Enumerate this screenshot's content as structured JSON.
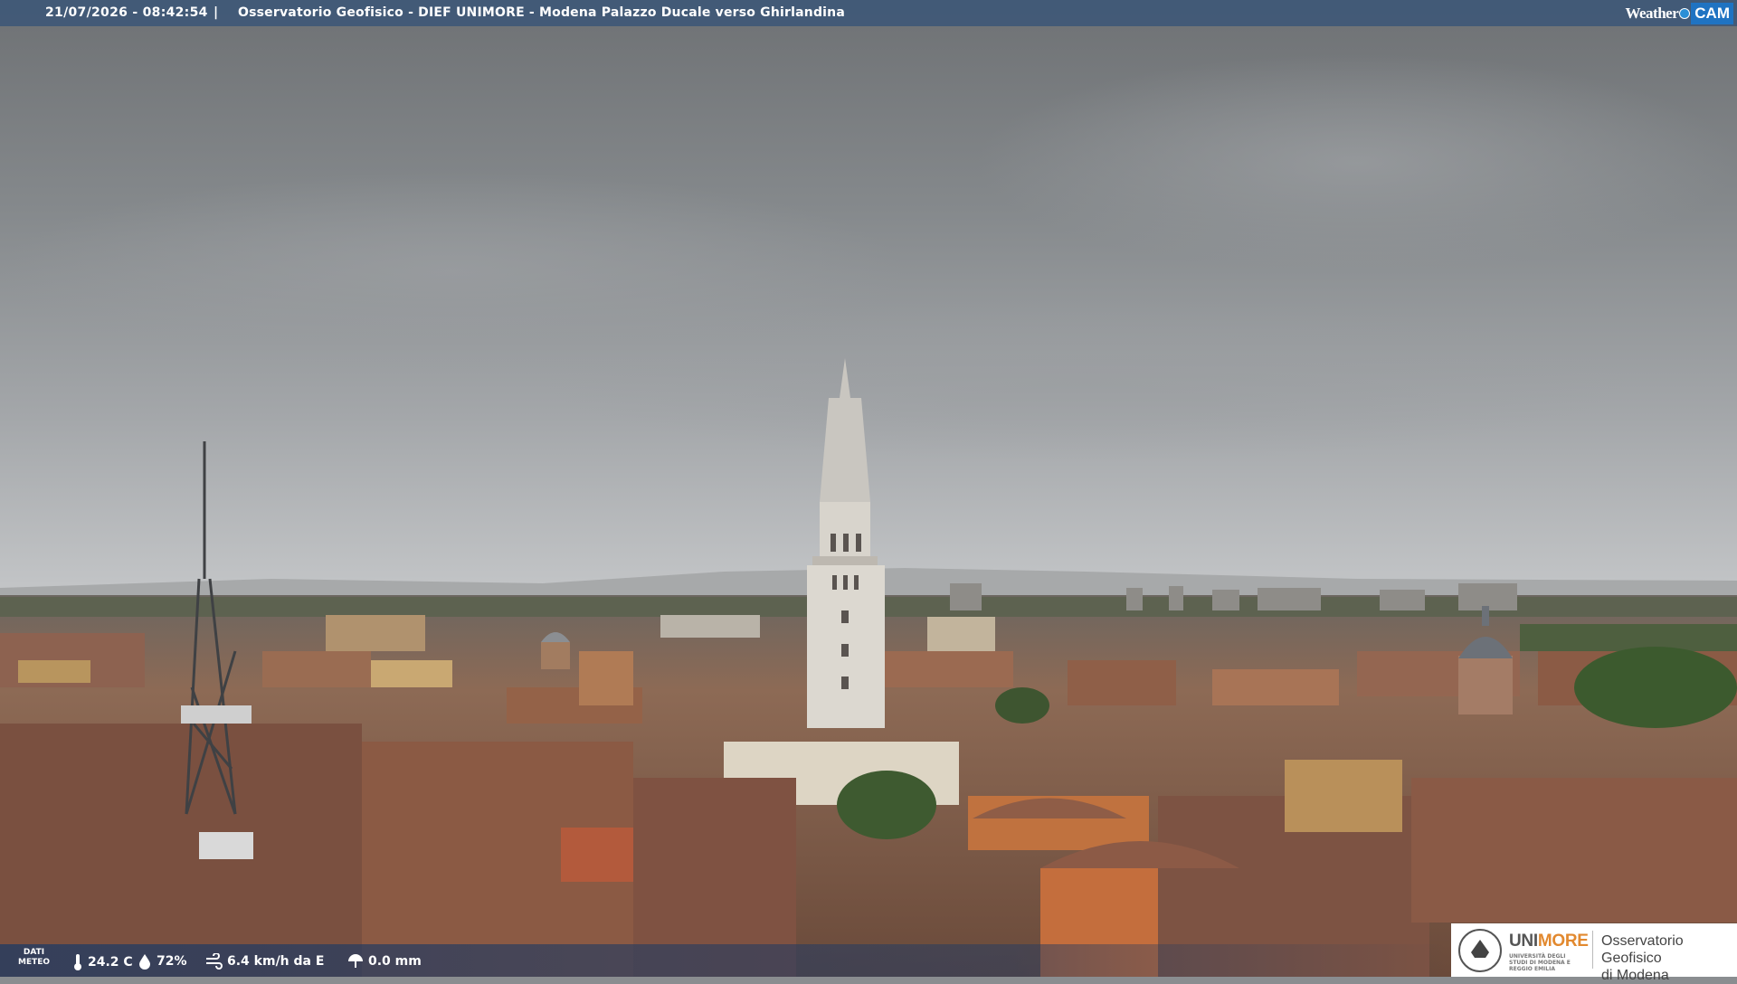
{
  "header": {
    "timestamp": "21/07/2026 - 08:42:54",
    "separator": "|",
    "title": "Osservatorio Geofisico - DIEF UNIMORE - Modena Palazzo Ducale verso Ghirlandina"
  },
  "brand": {
    "weather": "Weather",
    "cam": "CAM"
  },
  "weather": {
    "label_line1": "DATI",
    "label_line2": "METEO",
    "temperature": "24.2 C",
    "humidity": "72%",
    "wind": "6.4 km/h da E",
    "rain": "0.0 mm",
    "icons": [
      "thermometer-icon",
      "humidity-drop-icon",
      "wind-icon",
      "rain-umbrella-icon"
    ]
  },
  "logo": {
    "unimore_uni": "UNI",
    "unimore_more": "MORE",
    "unimore_sub": "UNIVERSITÀ DEGLI STUDI DI MODENA E REGGIO EMILIA",
    "observatory_line1": "Osservatorio Geofisico",
    "observatory_line2": "di Modena"
  },
  "colors": {
    "bar": "#3c5678",
    "cam_blue": "#1f73c2",
    "unimore_orange": "#e2892f",
    "sky": "#8a8d90",
    "roofs": "#8a5a44"
  }
}
